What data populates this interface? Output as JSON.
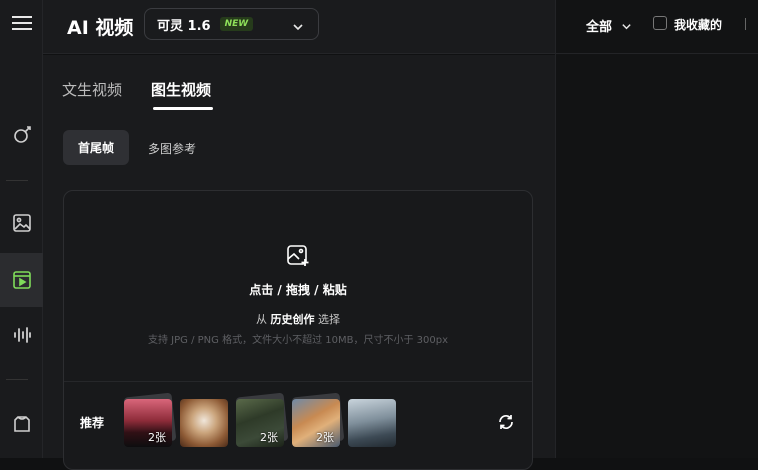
{
  "header": {
    "brand": "AI 视频",
    "model_name": "可灵 1.6",
    "model_badge": "NEW"
  },
  "right_panel": {
    "filter_label": "全部",
    "favorites_label": "我收藏的"
  },
  "tabs": [
    {
      "label": "文生视频",
      "active": false
    },
    {
      "label": "图生视频",
      "active": true
    }
  ],
  "modes": [
    {
      "label": "首尾帧",
      "active": true
    },
    {
      "label": "多图参考",
      "active": false
    }
  ],
  "upload": {
    "main_text": "点击 / 拖拽 / 粘贴",
    "from_prefix": "从",
    "from_link": "历史创作",
    "from_suffix": "选择",
    "hint": "支持 JPG / PNG 格式，文件大小不超过 10MB，尺寸不小于 300px"
  },
  "recommend": {
    "label": "推荐",
    "items": [
      {
        "count": "2张"
      },
      {
        "count": ""
      },
      {
        "count": "2张"
      },
      {
        "count": "2张"
      },
      {
        "count": ""
      }
    ]
  },
  "colors": {
    "accent_green": "#8ee05a",
    "active_rail_icon": "#7fdc5a"
  }
}
